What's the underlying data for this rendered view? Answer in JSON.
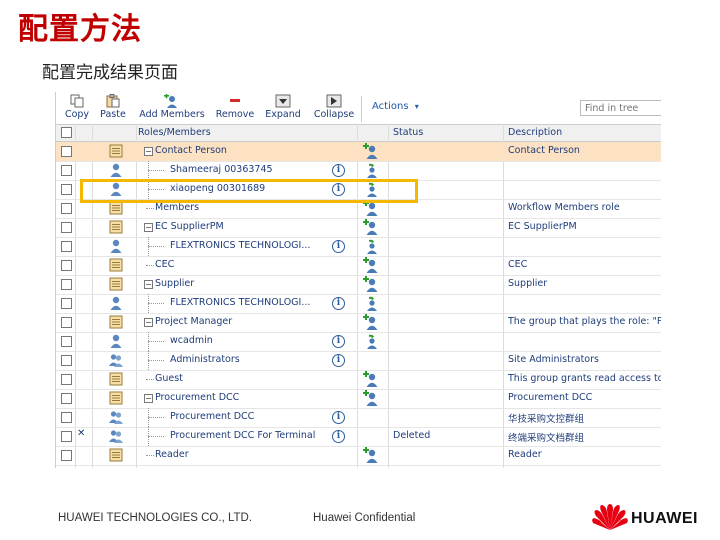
{
  "slide": {
    "title": "配置方法",
    "subtitle": "配置完成结果页面"
  },
  "toolbar": {
    "copy": "Copy",
    "paste": "Paste",
    "add_members": "Add Members",
    "remove": "Remove",
    "expand": "Expand",
    "collapse": "Collapse",
    "actions": "Actions",
    "actions_arrow": "▾",
    "find_placeholder": "Find in tree"
  },
  "table": {
    "columns": {
      "roles": "Roles/Members",
      "status": "Status",
      "description": "Description"
    },
    "rows": [
      {
        "name": "Contact Person",
        "type": "role",
        "level": 0,
        "toggle": "−",
        "action": "add-member",
        "status": "",
        "description": "Contact Person",
        "selected": true,
        "info": false,
        "mark": ""
      },
      {
        "name": "Shameeraj 00363745",
        "type": "user",
        "level": 1,
        "toggle": "",
        "action": "user-role",
        "status": "",
        "description": "",
        "selected": false,
        "info": true,
        "mark": ""
      },
      {
        "name": "xiaopeng 00301689",
        "type": "user",
        "level": 1,
        "toggle": "",
        "action": "user-role",
        "status": "",
        "description": "",
        "selected": false,
        "info": true,
        "mark": ""
      },
      {
        "name": "Members",
        "type": "role",
        "level": 0,
        "toggle": "",
        "action": "add-member",
        "status": "",
        "description": "Workflow Members role",
        "selected": false,
        "info": false,
        "mark": ""
      },
      {
        "name": "EC SupplierPM",
        "type": "role",
        "level": 0,
        "toggle": "−",
        "action": "add-member",
        "status": "",
        "description": "EC SupplierPM",
        "selected": false,
        "info": false,
        "mark": ""
      },
      {
        "name": "FLEXTRONICS TECHNOLOGI...",
        "type": "user",
        "level": 1,
        "toggle": "",
        "action": "user-role",
        "status": "",
        "description": "",
        "selected": false,
        "info": true,
        "mark": ""
      },
      {
        "name": "CEC",
        "type": "role",
        "level": 0,
        "toggle": "",
        "action": "add-member",
        "status": "",
        "description": "CEC",
        "selected": false,
        "info": false,
        "mark": ""
      },
      {
        "name": "Supplier",
        "type": "role",
        "level": 0,
        "toggle": "−",
        "action": "add-member",
        "status": "",
        "description": "Supplier",
        "selected": false,
        "info": false,
        "mark": ""
      },
      {
        "name": "FLEXTRONICS TECHNOLOGI...",
        "type": "user",
        "level": 1,
        "toggle": "",
        "action": "user-role",
        "status": "",
        "description": "",
        "selected": false,
        "info": true,
        "mark": ""
      },
      {
        "name": "Project Manager",
        "type": "role",
        "level": 0,
        "toggle": "−",
        "action": "add-member",
        "status": "",
        "description": "The group that plays the role: \"Pr",
        "selected": false,
        "info": false,
        "mark": ""
      },
      {
        "name": "wcadmin",
        "type": "user",
        "level": 1,
        "toggle": "",
        "action": "user-role",
        "status": "",
        "description": "",
        "selected": false,
        "info": true,
        "mark": ""
      },
      {
        "name": "Administrators",
        "type": "group",
        "level": 1,
        "toggle": "",
        "action": "",
        "status": "",
        "description": "Site Administrators",
        "selected": false,
        "info": true,
        "mark": ""
      },
      {
        "name": "Guest",
        "type": "role",
        "level": 0,
        "toggle": "",
        "action": "add-member",
        "status": "",
        "description": "This group grants read access to",
        "selected": false,
        "info": false,
        "mark": ""
      },
      {
        "name": "Procurement DCC",
        "type": "role",
        "level": 0,
        "toggle": "−",
        "action": "add-member",
        "status": "",
        "description": "Procurement DCC",
        "selected": false,
        "info": false,
        "mark": ""
      },
      {
        "name": "Procurement DCC",
        "type": "group",
        "level": 1,
        "toggle": "",
        "action": "",
        "status": "",
        "description": "华技采购文控群组",
        "selected": false,
        "info": true,
        "mark": ""
      },
      {
        "name": "Procurement DCC For Terminal",
        "type": "group",
        "level": 1,
        "toggle": "",
        "action": "",
        "status": "Deleted",
        "description": "终端采购文档群组",
        "selected": false,
        "info": true,
        "mark": "✕"
      },
      {
        "name": "Reader",
        "type": "role",
        "level": 0,
        "toggle": "",
        "action": "add-member",
        "status": "",
        "description": "Reader",
        "selected": false,
        "info": false,
        "mark": ""
      }
    ]
  },
  "footer": {
    "company": "HUAWEI TECHNOLOGIES CO., LTD.",
    "confidential": "Huawei Confidential",
    "logo_text": "HUAWEI"
  },
  "colors": {
    "title": "#c00000",
    "highlight": "#f5b800",
    "selected_row": "#fce2c2",
    "link_text": "#1f3d7a",
    "logo_red": "#e60012"
  }
}
